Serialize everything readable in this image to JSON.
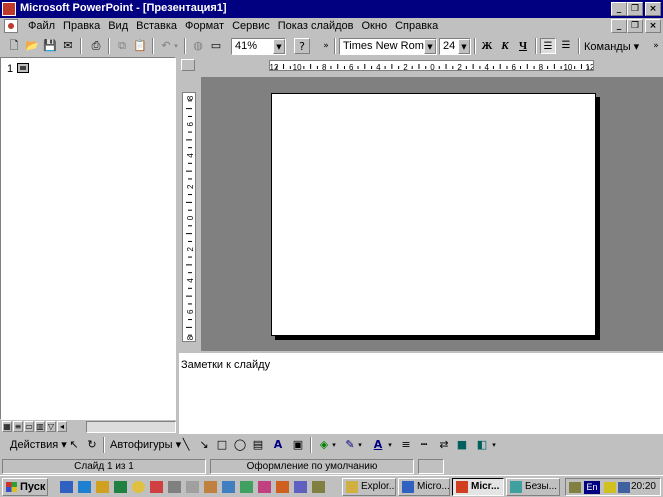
{
  "window": {
    "title": "Microsoft PowerPoint - [Презентация1]",
    "buttons": {
      "minimize": "_",
      "restore": "❐",
      "close": "×"
    }
  },
  "menu": {
    "items": [
      "Файл",
      "Правка",
      "Вид",
      "Вставка",
      "Формат",
      "Сервис",
      "Показ слайдов",
      "Окно",
      "Справка"
    ]
  },
  "toolbar": {
    "zoom": "41%",
    "font_name": "Times New Roman",
    "font_size": "24",
    "bold_label": "Ж",
    "italic_label": "К",
    "underline_label": "Ч",
    "commands_label": "Команды"
  },
  "outline": {
    "slide_number": "1"
  },
  "ruler": {
    "horizontal_ticks": [
      "12",
      "10",
      "8",
      "6",
      "4",
      "2",
      "0",
      "2",
      "4",
      "6",
      "8",
      "10",
      "12"
    ],
    "vertical_ticks": [
      "8",
      "6",
      "4",
      "2",
      "0",
      "2",
      "4",
      "6",
      "8"
    ]
  },
  "notes": {
    "placeholder": "Заметки к слайду"
  },
  "drawing": {
    "actions_label": "Действия",
    "autoshapes_label": "Автофигуры",
    "font_color_label": "A"
  },
  "status": {
    "slide": "Слайд 1 из 1",
    "design": "Оформление по умолчанию"
  },
  "taskbar": {
    "start_label": "Пуск",
    "tasks": [
      {
        "label": "Explor..."
      },
      {
        "label": "Micro..."
      },
      {
        "label": "Micr..."
      },
      {
        "label": "Безы..."
      }
    ],
    "language": "En",
    "clock": "20:20"
  }
}
